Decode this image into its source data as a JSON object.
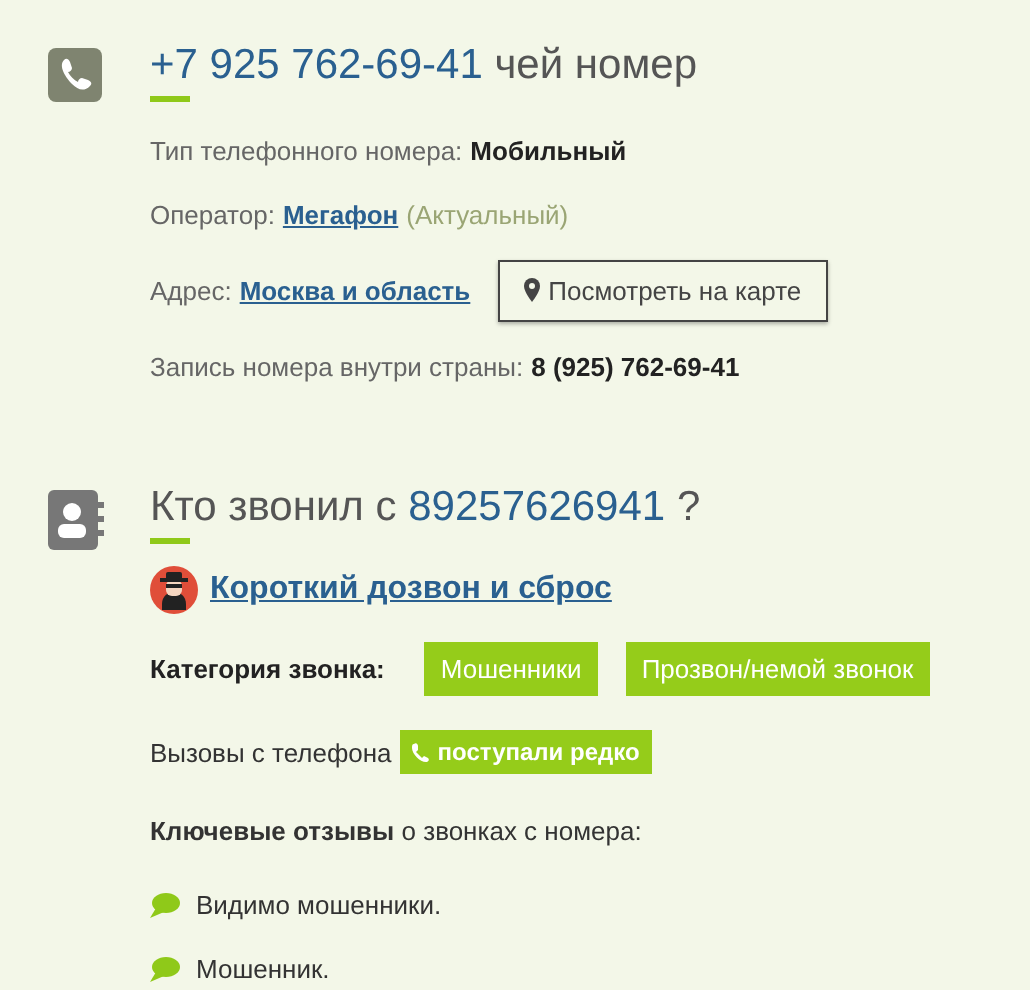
{
  "number_section": {
    "title_number": "+7 925 762-69-41",
    "title_text": "чей номер",
    "rows": [
      {
        "kind": "value",
        "label": "Тип телефонного номера:",
        "value": "Мобильный"
      },
      {
        "kind": "link",
        "label": "Оператор:",
        "link": "Мегафон",
        "note": "(Актуальный)"
      },
      {
        "kind": "map",
        "label": "Адрес:",
        "link": "Москва и область",
        "button": "Посмотреть на карте"
      },
      {
        "kind": "value",
        "label": "Запись номера внутри страны:",
        "value": "8 (925) 762-69-41"
      }
    ]
  },
  "caller_section": {
    "title_prefix": "Кто звонил с",
    "title_number": "89257626941",
    "title_suffix": "?",
    "verdict": "Короткий дозвон и сброс",
    "category_label": "Категория звонка:",
    "categories": [
      "Мошенники",
      "Прозвон/немой звонок"
    ],
    "calls_label": "Вызовы с телефона",
    "calls_badge": "поступали редко",
    "reviews_heading": "**Ключевые отзывы** о звонках с номера:",
    "reviews": [
      "Видимо мошенники.",
      "Мошенник."
    ]
  }
}
